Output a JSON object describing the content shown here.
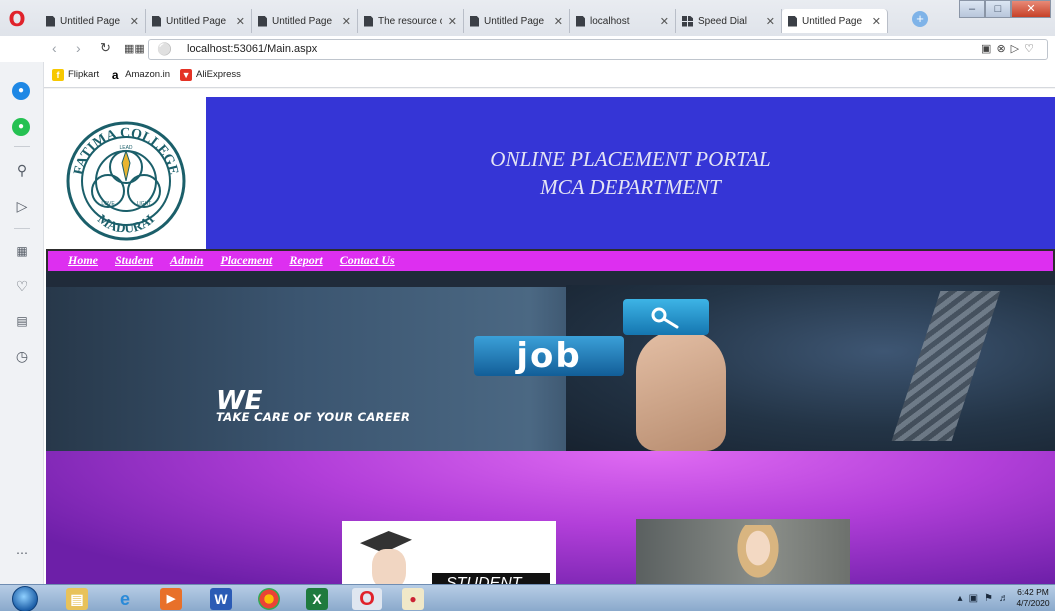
{
  "browser": {
    "tabs": [
      {
        "title": "Untitled Page",
        "icon": "page-icon",
        "active": false
      },
      {
        "title": "Untitled Page",
        "icon": "page-icon",
        "active": false
      },
      {
        "title": "Untitled Page",
        "icon": "page-icon",
        "active": false
      },
      {
        "title": "The resource ca",
        "icon": "page-icon",
        "active": false
      },
      {
        "title": "Untitled Page",
        "icon": "page-icon",
        "active": false
      },
      {
        "title": "localhost",
        "icon": "page-icon",
        "active": false
      },
      {
        "title": "Speed Dial",
        "icon": "speed-dial-icon",
        "active": false
      },
      {
        "title": "Untitled Page",
        "icon": "page-icon",
        "active": true
      }
    ],
    "address": {
      "url": "localhost:53061/Main.aspx"
    },
    "bookmarks": [
      {
        "label": "Flipkart",
        "icon": "flipkart-icon",
        "color": "#f7c800"
      },
      {
        "label": "Amazon.in",
        "icon": "amazon-icon",
        "color": "#000000"
      },
      {
        "label": "AliExpress",
        "icon": "aliexpress-icon",
        "color": "#e43225"
      }
    ]
  },
  "page": {
    "banner_title": "ONLINE PLACEMENT PORTAL",
    "banner_subtitle": "MCA DEPARTMENT",
    "banner_color": "#3535d6",
    "menu_color": "#dd2ff0",
    "logo": {
      "college": "FATIMA COLLEGE",
      "city": "MADURAI",
      "motto_top": "LEAD",
      "motto_left": "LOVE",
      "motto_right": "LIGHT"
    },
    "menu": [
      {
        "label": "Home"
      },
      {
        "label": "Student"
      },
      {
        "label": "Admin"
      },
      {
        "label": "Placement"
      },
      {
        "label": "Report"
      },
      {
        "label": "Contact Us"
      }
    ],
    "hero": {
      "badge": "job",
      "headline": "WE",
      "tagline": "TAKE CARE OF YOUR CAREER"
    },
    "cards": [
      {
        "label": "STUDENT"
      }
    ]
  },
  "taskbar": {
    "apps": [
      "explorer-icon",
      "ie-icon",
      "media-player-icon",
      "word-icon",
      "chrome-icon",
      "excel-icon",
      "opera-icon",
      "paint-icon"
    ],
    "clock_time": "6:42 PM",
    "clock_date": "4/7/2020"
  }
}
